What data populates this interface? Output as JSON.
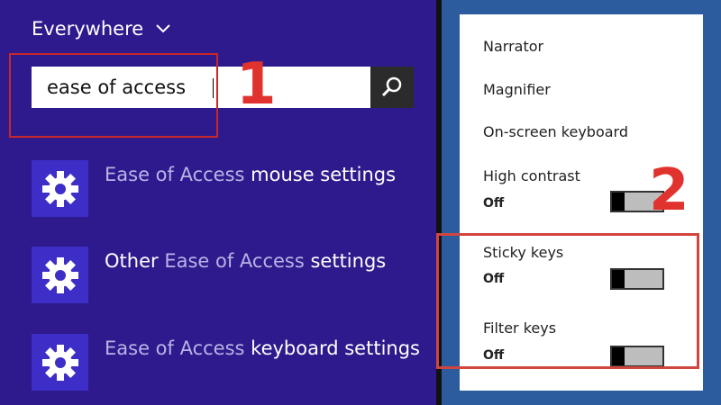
{
  "search": {
    "scope_label": "Everywhere",
    "query": "ease of access",
    "search_button_icon": "search-icon"
  },
  "results": [
    {
      "icon": "gear-icon",
      "highlight_before": "Ease of Access",
      "text_after": " mouse settings",
      "text_before": "",
      "highlight_after": ""
    },
    {
      "icon": "gear-icon",
      "text_before": "Other ",
      "highlight_before": "Ease of Access",
      "text_after": " settings",
      "highlight_after": ""
    },
    {
      "icon": "gear-icon",
      "highlight_before": "Ease of Access",
      "text_after": " keyboard settings",
      "text_before": "",
      "highlight_after": ""
    }
  ],
  "settings_panel": {
    "narrator": "Narrator",
    "magnifier": "Magnifier",
    "onscreen_keyboard": "On-screen keyboard",
    "high_contrast": {
      "label": "High contrast",
      "state": "Off"
    },
    "sticky_keys": {
      "label": "Sticky keys",
      "state": "Off"
    },
    "filter_keys": {
      "label": "Filter keys",
      "state": "Off"
    }
  },
  "annotations": {
    "step1": "1",
    "step2": "2"
  },
  "colors": {
    "background": "#2e1a8c",
    "tile": "#3d2ec7",
    "highlight_text": "#b9b3e6",
    "annotation_red": "#c8262a"
  }
}
